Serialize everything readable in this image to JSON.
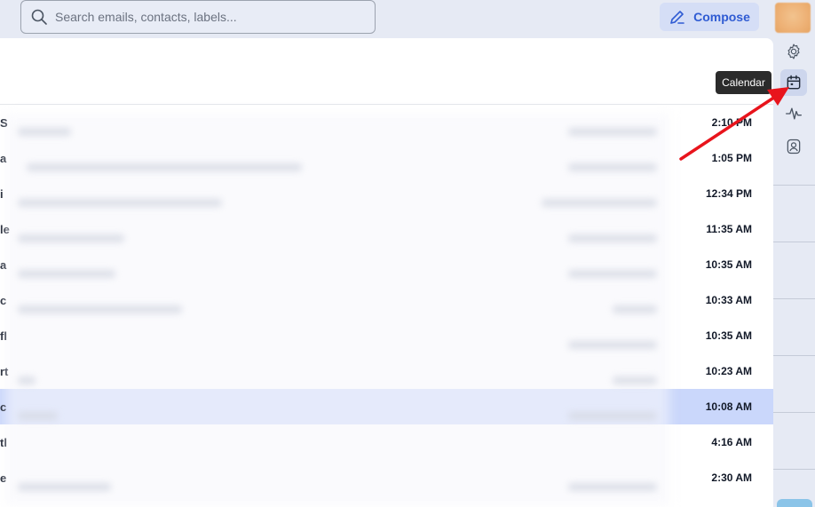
{
  "search": {
    "placeholder": "Search emails, contacts, labels..."
  },
  "toolbar": {
    "compose_label": "Compose"
  },
  "tooltip": {
    "text": "Calendar"
  },
  "emails": [
    {
      "sender_fragment": "S",
      "time": "2:10 PM"
    },
    {
      "sender_fragment": "a",
      "time": "1:05 PM"
    },
    {
      "sender_fragment": "i",
      "time": "12:34 PM"
    },
    {
      "sender_fragment": "le",
      "time": "11:35 AM"
    },
    {
      "sender_fragment": "a",
      "time": "10:35 AM"
    },
    {
      "sender_fragment": "c",
      "time": "10:33 AM"
    },
    {
      "sender_fragment": "fl",
      "time": "10:35 AM"
    },
    {
      "sender_fragment": "rt",
      "time": "10:23 AM"
    },
    {
      "sender_fragment": "c",
      "time": "10:08 AM",
      "selected": true
    },
    {
      "sender_fragment": "tl",
      "time": "4:16 AM"
    },
    {
      "sender_fragment": "e",
      "time": "2:30 AM"
    }
  ],
  "right_rail": [
    {
      "icon": "gear-icon"
    },
    {
      "icon": "calendar-icon",
      "active": true
    },
    {
      "icon": "activity-icon"
    },
    {
      "icon": "contacts-icon"
    }
  ],
  "colors": {
    "accent": "#2f5bd3",
    "selected_row": "#cad7fb",
    "annotation": "#e8141c"
  }
}
